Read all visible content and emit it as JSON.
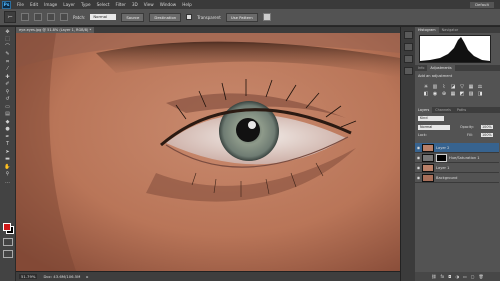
{
  "app": {
    "logo": "Ps",
    "workspace": "Default"
  },
  "menu": [
    "File",
    "Edit",
    "Image",
    "Layer",
    "Type",
    "Select",
    "Filter",
    "3D",
    "View",
    "Window",
    "Help"
  ],
  "options": {
    "tool_icon": "⤚",
    "patch_label": "Patch:",
    "patch_mode": "Normal",
    "source_label": "Source",
    "destination_label": "Destination",
    "transparent_label": "Transparent",
    "use_pattern_label": "Use Pattern"
  },
  "document": {
    "tab": "eye-eyes.jpg @ 51.8% (Layer 1, RGB/8) *"
  },
  "status": {
    "zoom": "51.79%",
    "doc": "Doc: 43.6M/106.5M"
  },
  "histogram_panel": {
    "tabs": [
      "Histogram",
      "Navigator"
    ]
  },
  "adjustments_panel": {
    "tabs": [
      "Info",
      "Adjustments"
    ],
    "title": "Add an adjustment"
  },
  "layers_panel": {
    "tabs": [
      "Layers",
      "Channels",
      "Paths"
    ],
    "kind": "Kind",
    "blend": "Normal",
    "opacity_label": "Opacity:",
    "opacity": "100%",
    "lock_label": "Lock:",
    "fill_label": "Fill:",
    "fill": "100%",
    "layers": [
      {
        "name": "Layer 2",
        "selected": true
      },
      {
        "name": "Hue/Saturation 1",
        "selected": false
      },
      {
        "name": "Layer 1",
        "selected": false
      },
      {
        "name": "Background",
        "selected": false
      }
    ]
  },
  "colors": {
    "foreground": "#d01818",
    "background": "#000000"
  }
}
